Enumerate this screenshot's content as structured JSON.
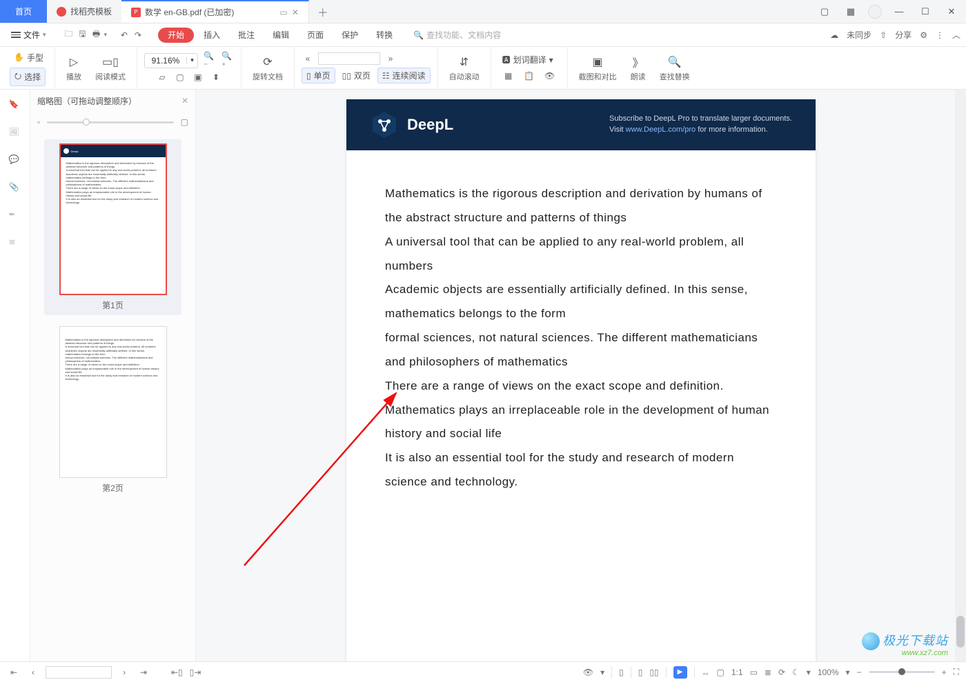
{
  "tabs": {
    "home": "首页",
    "template": "找稻壳模板",
    "doc": "数学 en-GB.pdf  (已加密)"
  },
  "menu": {
    "file": "文件",
    "undo_tip": "↶",
    "redo_tip": "↷",
    "items": [
      "开始",
      "插入",
      "批注",
      "编辑",
      "页面",
      "保护",
      "转换"
    ],
    "search_placeholder": "查找功能、文档内容",
    "right": {
      "sync": "未同步",
      "share": "分享"
    }
  },
  "toolbar": {
    "hand": "手型",
    "select": "选择",
    "play": "播放",
    "read_mode": "阅读模式",
    "zoom_value": "91.16%",
    "rotate": "旋转文档",
    "single": "单页",
    "double": "双页",
    "continuous": "连续阅读",
    "autoscroll": "自动滚动",
    "translate": "划词翻译",
    "screenshot": "截图和对比",
    "read_aloud": "朗读",
    "find": "查找替换"
  },
  "thumbs": {
    "title": "缩略图（可拖动调整顺序）",
    "pages": [
      "第1页",
      "第2页"
    ]
  },
  "deepl": {
    "brand": "DeepL",
    "sub1": "Subscribe to DeepL Pro to translate larger documents.",
    "sub2a": "Visit ",
    "sub2link": "www.DeepL.com/pro",
    "sub2b": " for more information."
  },
  "content": {
    "p1": "Mathematics is the rigorous description and derivation by humans of the abstract structure and patterns of things",
    "p2": "A universal tool that can be applied to any real-world problem, all numbers",
    "p3": "Academic objects are essentially artificially defined. In this sense, mathematics belongs to the form",
    "p4": "formal sciences, not natural sciences. The different mathematicians and philosophers of mathematics",
    "p5": "There are a range of views on the exact scope and definition.",
    "p6": "Mathematics plays an irreplaceable role in the development of human history and social life",
    "p7": "It is also an essential tool for the study and research of modern science and technology."
  },
  "status": {
    "zoom": "100%",
    "page_input": ""
  },
  "watermark": {
    "l1": "极光下载站",
    "l2": "www.xz7.com"
  }
}
